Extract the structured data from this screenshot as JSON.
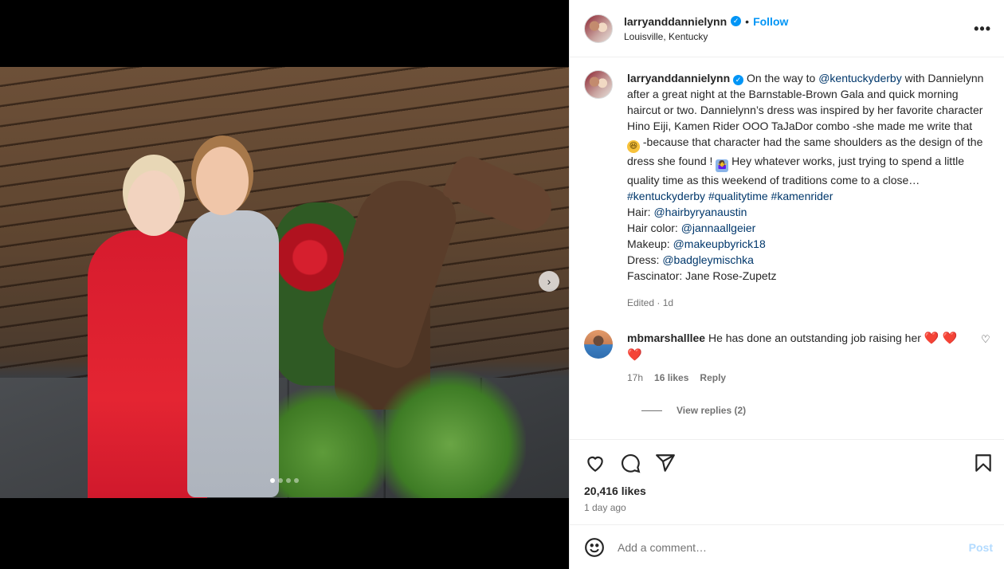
{
  "post": {
    "header": {
      "username": "larryanddannielynn",
      "verified_icon": "verified-badge-icon",
      "separator": "•",
      "follow_label": "Follow",
      "location": "Louisville, Kentucky",
      "more_icon": "more-options-icon",
      "more_glyph": "•••"
    },
    "caption": {
      "username": "larryanddannielynn",
      "text_1": "On the way to ",
      "mention_1": "@kentuckyderby",
      "text_2": " with Dannielynn after a great night at the Barnstable-Brown Gala and quick morning haircut or two. Dannielynn’s dress was inspired by her favorite character Hino Eiji, Kamen Rider OOO TaJaDor combo -she made me write that ",
      "emoji_1": "😆",
      "text_3": " -because that character had the same shoulders as the design of the dress she found ! ",
      "emoji_2": "🤷‍♀️",
      "text_4": " Hey whatever works, just trying to spend a little quality time as this weekend of traditions come to a close…",
      "hashtags": [
        "#kentuckyderby",
        "#qualitytime",
        "#kamenrider"
      ],
      "credits": [
        {
          "label": "Hair: ",
          "handle": "@hairbyryanaustin"
        },
        {
          "label": "Hair color: ",
          "handle": "@jannaallgeier"
        },
        {
          "label": "Makeup: ",
          "handle": "@makeupbyrick18"
        },
        {
          "label": "Dress: ",
          "handle": "@badgleymischka"
        },
        {
          "label": "Fascinator: Jane Rose-Zupetz",
          "handle": ""
        }
      ],
      "edited": "Edited · 1d"
    },
    "comment": {
      "username": "mbmarshalllee",
      "text": "He has done an outstanding job raising her",
      "hearts": "❤️ ❤️ ❤️",
      "time": "17h",
      "likes": "16 likes",
      "reply_label": "Reply",
      "view_replies": "View replies (2)",
      "like_icon": "heart-outline-icon",
      "like_glyph": "♡"
    },
    "media": {
      "carousel_dots": 4,
      "active_dot": 0,
      "next_icon": "chevron-right-icon",
      "next_glyph": "›"
    },
    "actions": {
      "like_icon": "heart-icon",
      "comment_icon": "comment-icon",
      "share_icon": "share-icon",
      "save_icon": "bookmark-icon",
      "likes_count": "20,416 likes",
      "date": "1 day ago"
    },
    "composer": {
      "placeholder": "Add a comment…",
      "post_label": "Post",
      "emoji_icon": "emoji-smile-icon"
    }
  },
  "colors": {
    "accent": "#0095f6",
    "link": "#00376b",
    "muted": "#737373",
    "text": "#262626",
    "post_disabled": "#b3dbff"
  }
}
